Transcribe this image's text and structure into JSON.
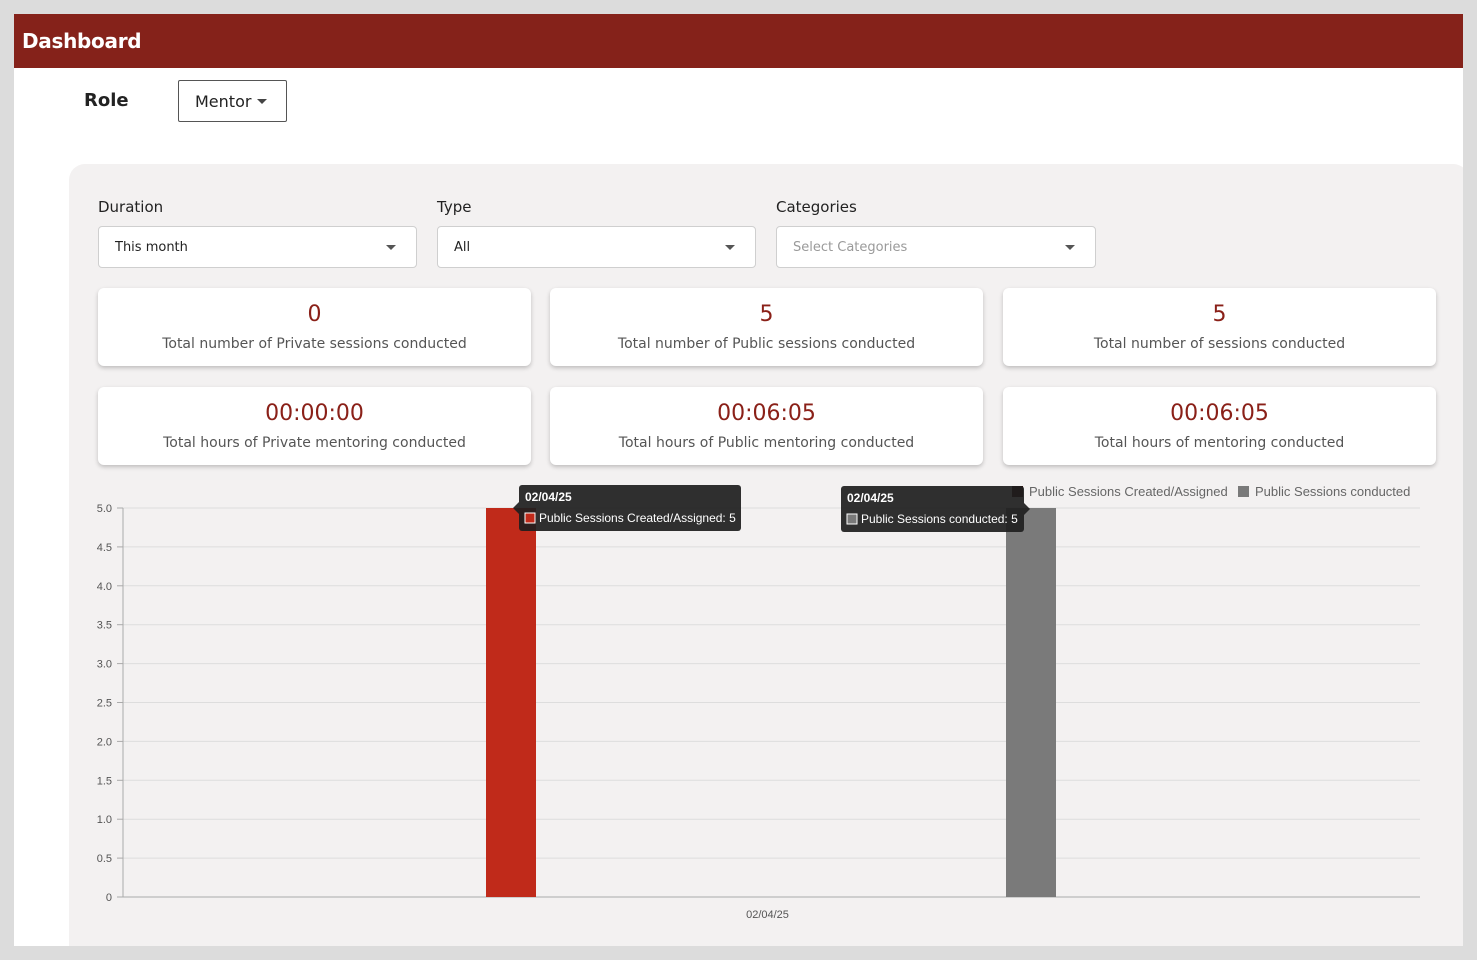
{
  "header": {
    "title": "Dashboard"
  },
  "role": {
    "label": "Role",
    "selected": "Mentor"
  },
  "filters": {
    "duration": {
      "label": "Duration",
      "value": "This month"
    },
    "type": {
      "label": "Type",
      "value": "All"
    },
    "categories": {
      "label": "Categories",
      "placeholder": "Select Categories"
    }
  },
  "cards": [
    {
      "value": "0",
      "label": "Total number of Private sessions conducted"
    },
    {
      "value": "5",
      "label": "Total number of Public sessions conducted"
    },
    {
      "value": "5",
      "label": "Total number of sessions conducted"
    },
    {
      "value": "00:00:00",
      "label": "Total hours of Private mentoring conducted"
    },
    {
      "value": "00:06:05",
      "label": "Total hours of Public mentoring conducted"
    },
    {
      "value": "00:06:05",
      "label": "Total hours of mentoring conducted"
    }
  ],
  "colors": {
    "accent": "#85221a",
    "value_text": "#8a2018",
    "series_created": "#c02a1a",
    "series_conducted": "#7a7a7a",
    "panel_bg": "#f3f1f1"
  },
  "chart_data": {
    "type": "bar",
    "categories": [
      "02/04/25"
    ],
    "series": [
      {
        "name": "Public Sessions Created/Assigned",
        "values": [
          5
        ],
        "color": "#c02a1a"
      },
      {
        "name": "Public Sessions conducted",
        "values": [
          5
        ],
        "color": "#7a7a7a"
      }
    ],
    "ylim": [
      0,
      5
    ],
    "yticks": [
      "0",
      "0.5",
      "1.0",
      "1.5",
      "2.0",
      "2.5",
      "3.0",
      "3.5",
      "4.0",
      "4.5",
      "5.0"
    ],
    "grid": true,
    "legend": "top-right",
    "tooltips": [
      {
        "title": "02/04/25",
        "text": "Public Sessions Created/Assigned: 5"
      },
      {
        "title": "02/04/25",
        "text": "Public Sessions conducted: 5"
      }
    ]
  }
}
